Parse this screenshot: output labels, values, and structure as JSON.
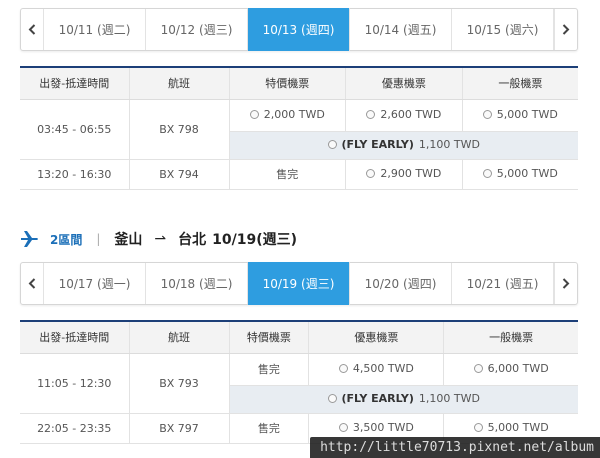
{
  "leg1": {
    "dates": [
      {
        "label": "10/11 (週二)",
        "active": false
      },
      {
        "label": "10/12 (週三)",
        "active": false
      },
      {
        "label": "10/13 (週四)",
        "active": true
      },
      {
        "label": "10/14 (週五)",
        "active": false
      },
      {
        "label": "10/15 (週六)",
        "active": false
      }
    ],
    "headers": [
      "出發-抵達時間",
      "航班",
      "特價機票",
      "優惠機票",
      "一般機票"
    ],
    "rows": [
      {
        "time": "03:45 - 06:55",
        "flight": "BX 798",
        "special": "2,000 TWD",
        "discount": "2,600 TWD",
        "regular": "5,000 TWD",
        "fly_early_label": "(FLY EARLY)",
        "fly_early_price": "1,100 TWD"
      },
      {
        "time": "13:20 - 16:30",
        "flight": "BX 794",
        "special": "售完",
        "discount": "2,900 TWD",
        "regular": "5,000 TWD"
      }
    ]
  },
  "route2": {
    "segment": "2區間",
    "from": "釜山",
    "arrow": "⇀",
    "to": "台北",
    "date": "10/19(週三)"
  },
  "leg2": {
    "dates": [
      {
        "label": "10/17 (週一)",
        "active": false
      },
      {
        "label": "10/18 (週二)",
        "active": false
      },
      {
        "label": "10/19 (週三)",
        "active": true
      },
      {
        "label": "10/20 (週四)",
        "active": false
      },
      {
        "label": "10/21 (週五)",
        "active": false
      }
    ],
    "headers": [
      "出發-抵達時間",
      "航班",
      "特價機票",
      "優惠機票",
      "一般機票"
    ],
    "rows": [
      {
        "time": "11:05 - 12:30",
        "flight": "BX 793",
        "special": "售完",
        "discount": "4,500 TWD",
        "regular": "6,000 TWD",
        "fly_early_label": "(FLY EARLY)",
        "fly_early_price": "1,100 TWD"
      },
      {
        "time": "22:05 - 23:35",
        "flight": "BX 797",
        "special": "售完",
        "discount": "3,500 TWD",
        "regular": "5,000 TWD"
      }
    ]
  },
  "watermark": "http://little70713.pixnet.net/album",
  "colors": {
    "accent": "#2e9de0",
    "header_border": "#1c3f78",
    "segment": "#1b6fb8",
    "fly_early_bg": "#e8edf2"
  }
}
